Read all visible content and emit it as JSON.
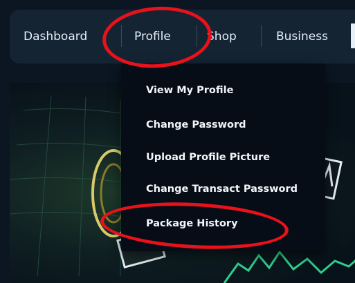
{
  "nav": {
    "items": [
      {
        "label": "Dashboard"
      },
      {
        "label": "Profile"
      },
      {
        "label": "Shop"
      },
      {
        "label": "Business"
      }
    ]
  },
  "profile_menu": {
    "items": [
      {
        "label": "View My Profile"
      },
      {
        "label": "Change Password"
      },
      {
        "label": "Upload Profile Picture"
      },
      {
        "label": "Change Transact Password"
      },
      {
        "label": "Package History"
      }
    ]
  },
  "colors": {
    "background": "#0b1622",
    "navbar": "#152433",
    "dropdown": "#060d17",
    "text": "#f2f6fb",
    "annotation": "#e8121b"
  },
  "icons": [
    "chart-icon",
    "emblem-icon"
  ]
}
